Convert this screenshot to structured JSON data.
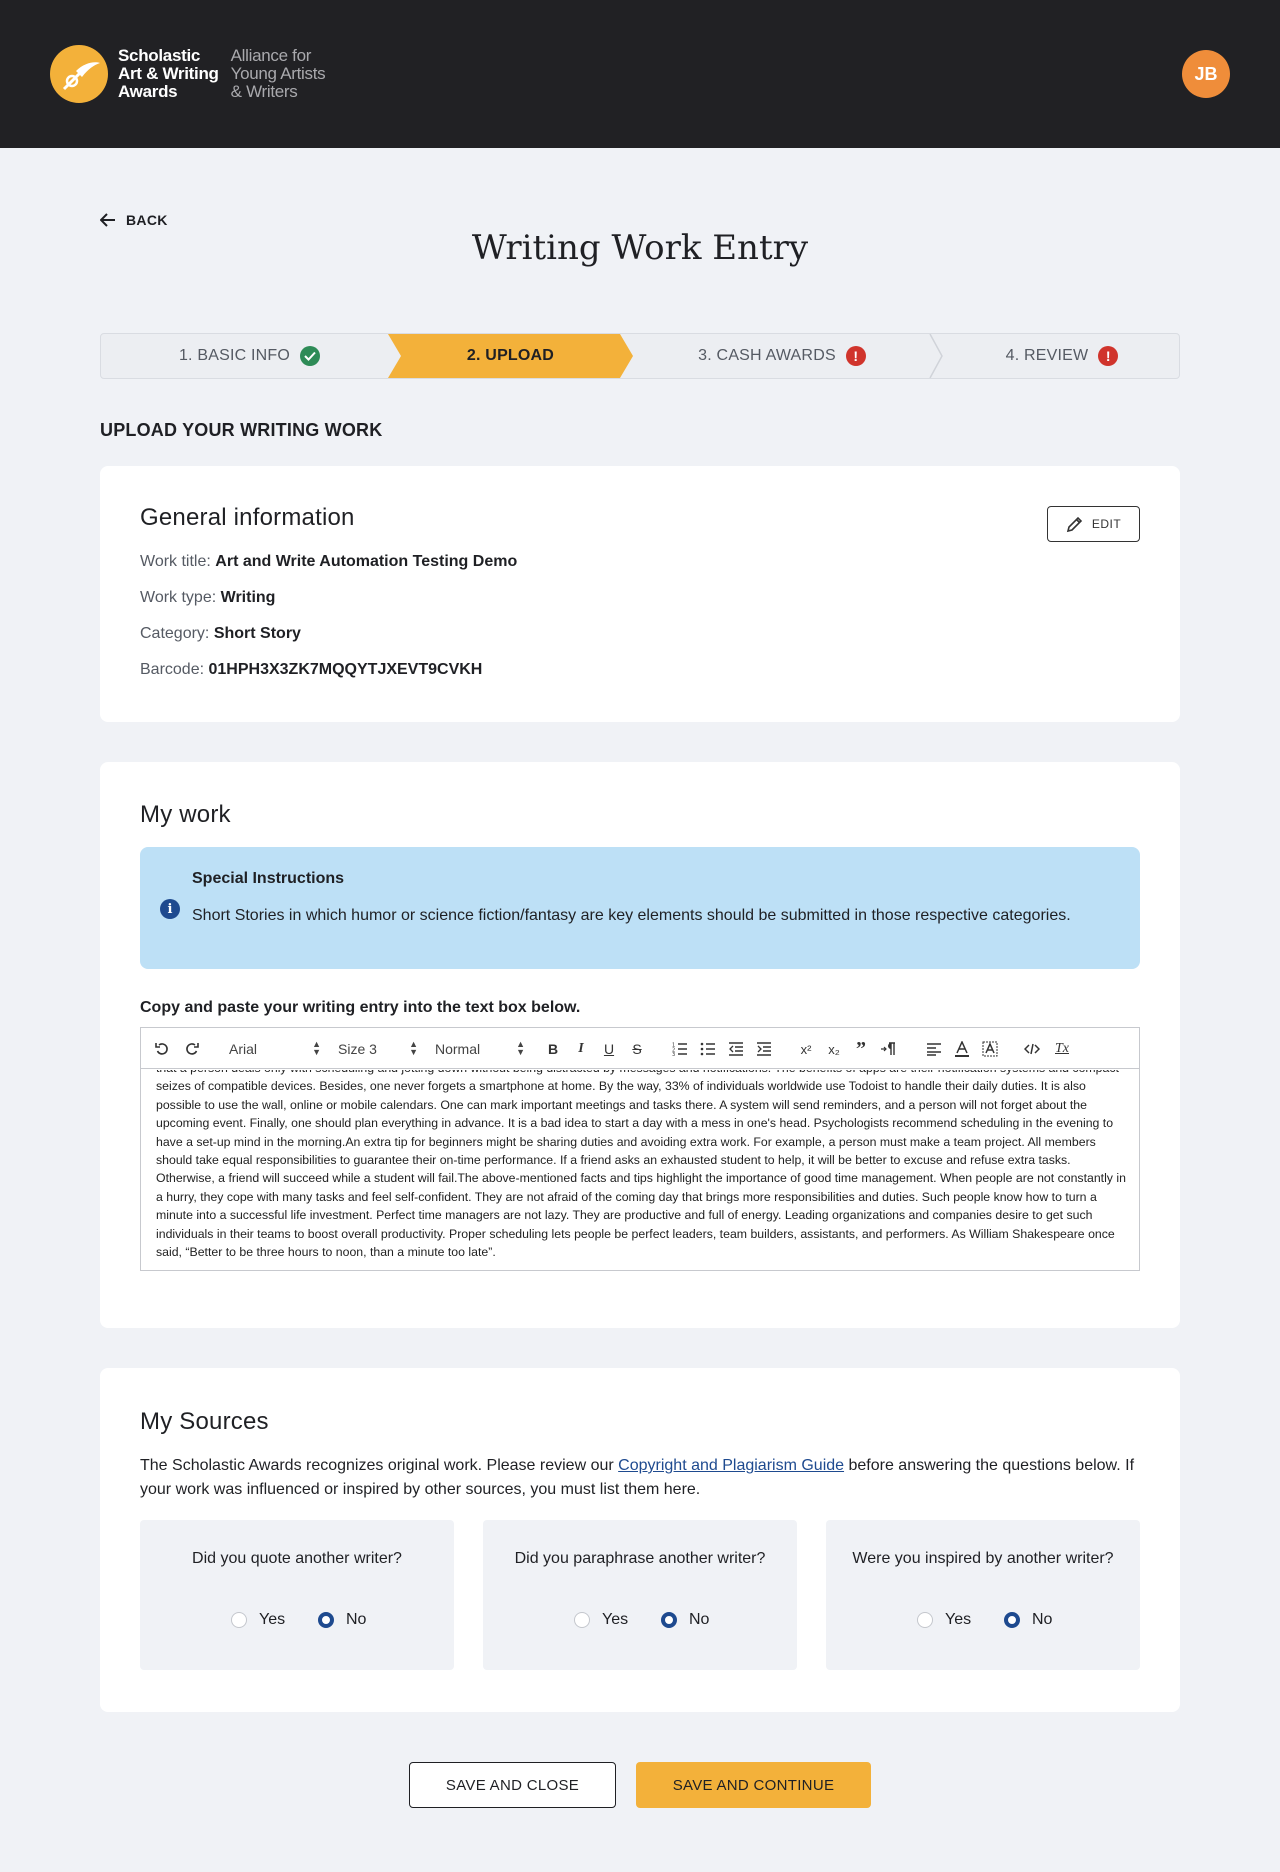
{
  "header": {
    "logo_main": [
      "Scholastic",
      "Art & Writing",
      "Awards"
    ],
    "logo_sub": [
      "Alliance for",
      "Young Artists",
      "& Writers"
    ],
    "avatar_initials": "JB"
  },
  "nav": {
    "back_label": "BACK"
  },
  "page": {
    "title": "Writing Work Entry",
    "section_heading": "UPLOAD YOUR WRITING WORK"
  },
  "stepper": {
    "steps": [
      {
        "label": "1. BASIC INFO",
        "status": "complete"
      },
      {
        "label": "2. UPLOAD",
        "status": "active"
      },
      {
        "label": "3. CASH AWARDS",
        "status": "error"
      },
      {
        "label": "4. REVIEW",
        "status": "error"
      }
    ],
    "error_glyph": "!"
  },
  "general": {
    "title": "General information",
    "edit_label": "EDIT",
    "rows": [
      {
        "label": "Work title:",
        "value": "Art and Write Automation Testing Demo"
      },
      {
        "label": "Work type:",
        "value": "Writing"
      },
      {
        "label": "Category:",
        "value": "Short Story"
      },
      {
        "label": "Barcode:",
        "value": "01HPH3X3ZK7MQQYTJXEVT9CVKH"
      }
    ]
  },
  "mywork": {
    "title": "My work",
    "notice_title": "Special Instructions",
    "notice_body": "Short Stories in which humor or science fiction/fantasy are key elements should be submitted in those respective categories.",
    "notice_icon": "i",
    "paste_label": "Copy and paste your writing entry into the text box below.",
    "toolbar": {
      "font": "Arial",
      "size": "Size 3",
      "format": "Normal",
      "bold": "B",
      "italic": "I",
      "underline": "U",
      "strike": "S",
      "superscript": "x²",
      "subscript": "x₂",
      "quote": "”",
      "clear": "Tx"
    },
    "editor_text": "that a person deals only with scheduling and jotting down without being distracted by messages and notifications. The benefits of apps are their notification systems and compact seizes of compatible devices. Besides, one never forgets a smartphone at home. By the way, 33% of individuals worldwide use Todoist to handle their daily duties. It is also possible to use the wall, online or mobile calendars. One can mark important meetings and tasks there. A system will send reminders, and a person will not forget about the upcoming event. Finally, one should plan everything in advance. It is a bad idea to start a day with a mess in one's head. Psychologists recommend scheduling in the evening to have a set-up mind in the morning.An extra tip for beginners might be sharing duties and avoiding extra work. For example, a person must make a team project. All members should take equal responsibilities to guarantee their on-time performance. If a friend asks an exhausted student to help, it will be better to excuse and refuse extra tasks. Otherwise, a friend will succeed while a student will fail.The above-mentioned facts and tips highlight the importance of good time management. When people are not constantly in a hurry, they cope with many tasks and feel self-confident. They are not afraid of the coming day that brings more responsibilities and duties. Such people know how to turn a minute into a successful life investment. Perfect time managers are not lazy. They are productive and full of energy. Leading organizations and companies desire to get such individuals in their teams to boost overall productivity. Proper scheduling lets people be perfect leaders, team builders, assistants, and performers. As William Shakespeare once said, “Better to be three hours to noon, than a minute too late”."
  },
  "sources": {
    "title": "My Sources",
    "desc_before": "The Scholastic Awards recognizes original work. Please review our ",
    "desc_link": "Copyright and Plagiarism Guide",
    "desc_after": " before answering the questions below. If your work was influenced or inspired by other sources, you must list them here.",
    "questions": [
      {
        "q": "Did you quote another writer?",
        "yes": "Yes",
        "no": "No",
        "selected": "No"
      },
      {
        "q": "Did you paraphrase another writer?",
        "yes": "Yes",
        "no": "No",
        "selected": "No"
      },
      {
        "q": "Were you inspired by another writer?",
        "yes": "Yes",
        "no": "No",
        "selected": "No"
      }
    ]
  },
  "actions": {
    "save_close": "SAVE AND CLOSE",
    "save_continue": "SAVE AND CONTINUE"
  },
  "colors": {
    "accent": "#f3b13a",
    "header_bg": "#212124",
    "avatar": "#ef8d3a",
    "success": "#2e8b57",
    "error": "#d0342c",
    "link": "#1e4a8f",
    "notice_bg": "#bde0f6"
  }
}
